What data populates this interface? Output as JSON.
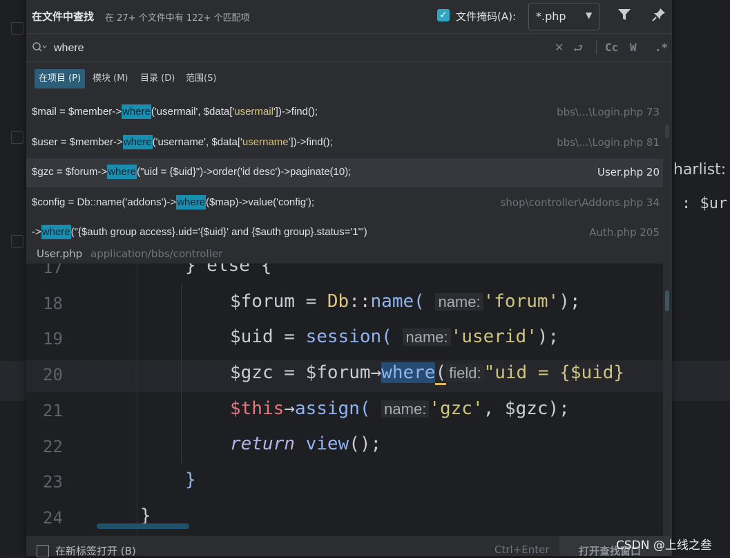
{
  "header": {
    "title": "在文件中查找",
    "subtitle": "在 27+ 个文件中有 122+ 个匹配项",
    "file_mask_label": "文件掩码(A):",
    "file_mask_value": "*.php"
  },
  "search": {
    "query": "where",
    "case_label": "Cc",
    "words_label": "W",
    "regex_label": ".*"
  },
  "scope_tabs": [
    "在项目 (P)",
    "模块 (M)",
    "目录 (D)",
    "范围(S)"
  ],
  "results": [
    {
      "pre": "$mail = $member->",
      "match": "where",
      "post1": "('usermail', $data['",
      "str": "usermail",
      "post2": "'])->find();",
      "file": "bbs\\...\\Login.php 73"
    },
    {
      "pre": "$user = $member->",
      "match": "where",
      "post1": "('username', $data['",
      "str": "username",
      "post2": "'])->find();",
      "file": "bbs\\...\\Login.php 81"
    },
    {
      "pre": "$gzc = $forum->",
      "match": "where",
      "post1": "(\"uid = {$uid}\")->order('id desc')->paginate(10);",
      "str": "",
      "post2": "",
      "file": "User.php 20"
    },
    {
      "pre": "$config  =  Db::name('addons')->",
      "match": "where",
      "post1": "($map)->value('config');",
      "str": "",
      "post2": "",
      "file": "shop\\controller\\Addons.php 34"
    },
    {
      "pre": "->",
      "match": "where",
      "post1": "(\"{$auth group access}.uid='{$uid}' and {$auth group}.status='1'\")",
      "str": "",
      "post2": "",
      "file": "Auth.php 205"
    }
  ],
  "preview": {
    "file": "User.php",
    "path": "application/bbs/controller",
    "line_numbers": [
      "17",
      "18",
      "19",
      "20",
      "21",
      "22",
      "23",
      "24"
    ],
    "line17": "} else {",
    "line18": {
      "var": "$forum",
      "eq": " = ",
      "cls": "Db",
      "op": "::",
      "fn": "name(",
      "hint": "name:",
      "str": "'forum'",
      "end": ");"
    },
    "line19": {
      "var": "$uid",
      "eq": " = ",
      "fn": "session(",
      "hint": "name:",
      "str": "'userid'",
      "end": ");"
    },
    "line20": {
      "var": "$gzc",
      "eq": " = ",
      "obj": "$forum",
      "arrow": "→",
      "fn": "where",
      "paren": "(",
      "hint": "field:",
      "str": "\"uid = {$uid}"
    },
    "line21": {
      "kw": "$this",
      "arrow": "→",
      "fn": "assign(",
      "hint": "name:",
      "str": "'gzc'",
      "rest": ", $gzc);"
    },
    "line22": {
      "kw": "return",
      "fn": "view",
      "end": "();"
    },
    "line23": "}",
    "line24": "}"
  },
  "background": {
    "line1": "harlist:",
    "line2": ": $ur"
  },
  "footer": {
    "new_tab_label": "在新标签打开 (B)",
    "shortcut": "Ctrl+Enter",
    "open_button": "打开查找窗口"
  },
  "watermark": "CSDN @上线之叁"
}
